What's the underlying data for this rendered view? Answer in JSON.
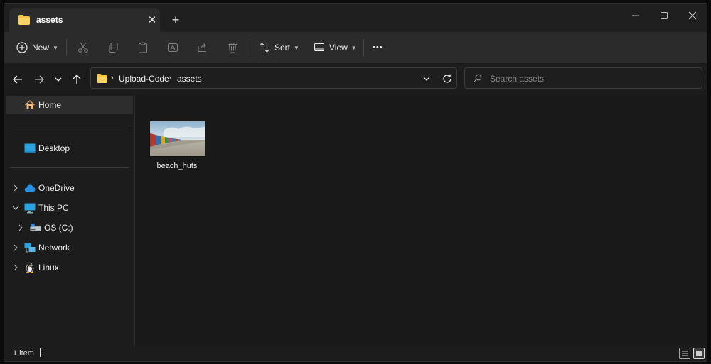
{
  "tab": {
    "title": "assets",
    "close_glyph": "✕",
    "new_tab_glyph": "+"
  },
  "window_controls": {
    "minimize": "—",
    "maximize": "☐",
    "close": "✕"
  },
  "toolbar": {
    "new_label": "New",
    "sort_label": "Sort",
    "view_label": "View",
    "more_label": "•••",
    "icons": [
      "cut-icon",
      "copy-icon",
      "paste-icon",
      "rename-icon",
      "share-icon",
      "delete-icon"
    ]
  },
  "address": {
    "crumbs": [
      "Upload-Code",
      "assets"
    ],
    "separator": "›"
  },
  "search": {
    "placeholder": "Search assets",
    "value": ""
  },
  "sidebar": {
    "items": [
      {
        "label": "Home"
      },
      {
        "label": "Desktop"
      },
      {
        "label": "OneDrive"
      },
      {
        "label": "This PC"
      },
      {
        "label": "OS (C:)"
      },
      {
        "label": "Network"
      },
      {
        "label": "Linux"
      }
    ]
  },
  "files": [
    {
      "name": "beach_huts"
    }
  ],
  "status": {
    "count": "1 item"
  },
  "colors": {
    "accent": "#4cc2ff",
    "folder": "#f3c244",
    "background": "#191919"
  }
}
